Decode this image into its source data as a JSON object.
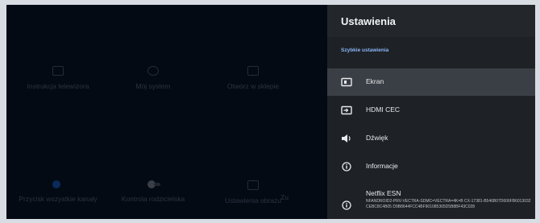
{
  "background": {
    "row1": [
      {
        "label": "Instrukcja telewizora",
        "icon": "tv-icon"
      },
      {
        "label": "Mój system",
        "icon": "home-icon"
      },
      {
        "label": "Otwórz w sklepie",
        "icon": "store-icon"
      }
    ],
    "row2": [
      {
        "label": "Przycisk wszystkie kanały",
        "icon": "toggle-on-icon"
      },
      {
        "label": "Kontrola rodzicielska",
        "icon": "toggle-off-icon"
      },
      {
        "label": "Ustawienia obrazu",
        "icon": "picture-icon"
      },
      {
        "label": "Zu",
        "icon": ""
      }
    ]
  },
  "panel": {
    "title": "Ustawienia",
    "section": "Szybkie ustawienia",
    "items": [
      {
        "label": "Ekran",
        "icon": "display-icon",
        "focused": true
      },
      {
        "label": "HDMI CEC",
        "icon": "input-icon",
        "focused": false
      },
      {
        "label": "Dźwięk",
        "icon": "speaker-icon",
        "focused": false
      },
      {
        "label": "Informacje",
        "icon": "info-icon",
        "focused": false
      }
    ],
    "esn": {
      "label": "Netflix ESN",
      "value": "NFANDROID2-PRV-VECTRA-SDMC=VECTRA=4K=B CX-17381-B546B07D606FB6013032CEBC8C4B05 D9B8644FCC4BF901085365D5B8BF43C028",
      "icon": "info-icon"
    }
  },
  "colors": {
    "panel_bg": "#1e2226",
    "focused_bg": "#3a3f45",
    "accent": "#8ab4f8"
  }
}
